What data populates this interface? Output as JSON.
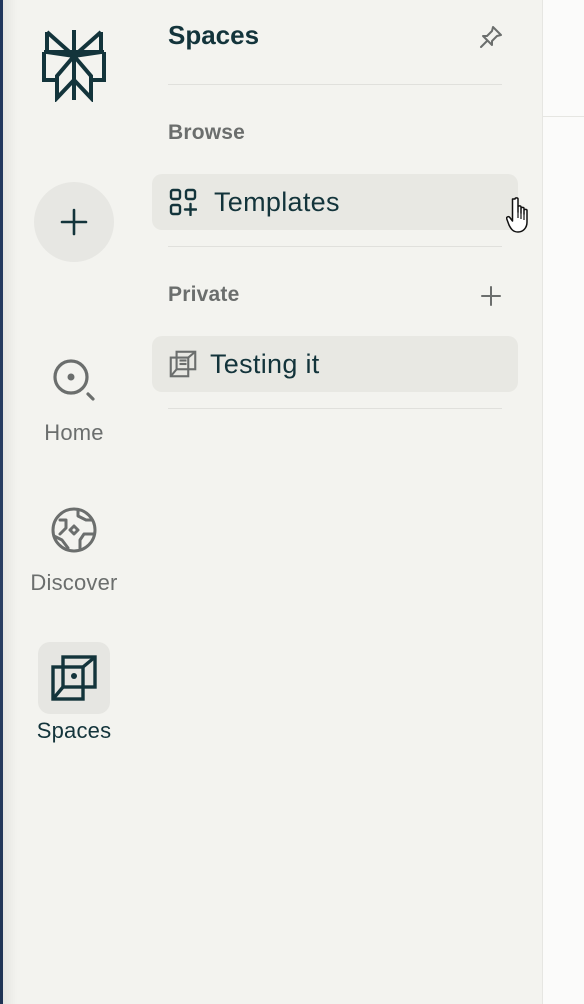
{
  "rail": {
    "logo_icon": "perplexity-logo-icon",
    "new_thread_icon": "plus-icon",
    "items": [
      {
        "label": "Home",
        "icon": "search-icon",
        "active": false
      },
      {
        "label": "Discover",
        "icon": "globe-icon",
        "active": false
      },
      {
        "label": "Spaces",
        "icon": "spaces-icon",
        "active": true
      }
    ]
  },
  "panel": {
    "title": "Spaces",
    "pin_icon": "pin-icon",
    "browse": {
      "label": "Browse",
      "items": [
        {
          "label": "Templates",
          "icon": "templates-icon"
        }
      ]
    },
    "private": {
      "label": "Private",
      "add_icon": "plus-icon",
      "items": [
        {
          "label": "Testing it",
          "icon": "spaces-icon"
        }
      ]
    }
  },
  "colors": {
    "background": "#f3f3ef",
    "text_primary": "#13343b",
    "text_secondary": "#6b6e6d",
    "row_highlight": "#e8e8e3",
    "left_edge": "#20365c"
  }
}
